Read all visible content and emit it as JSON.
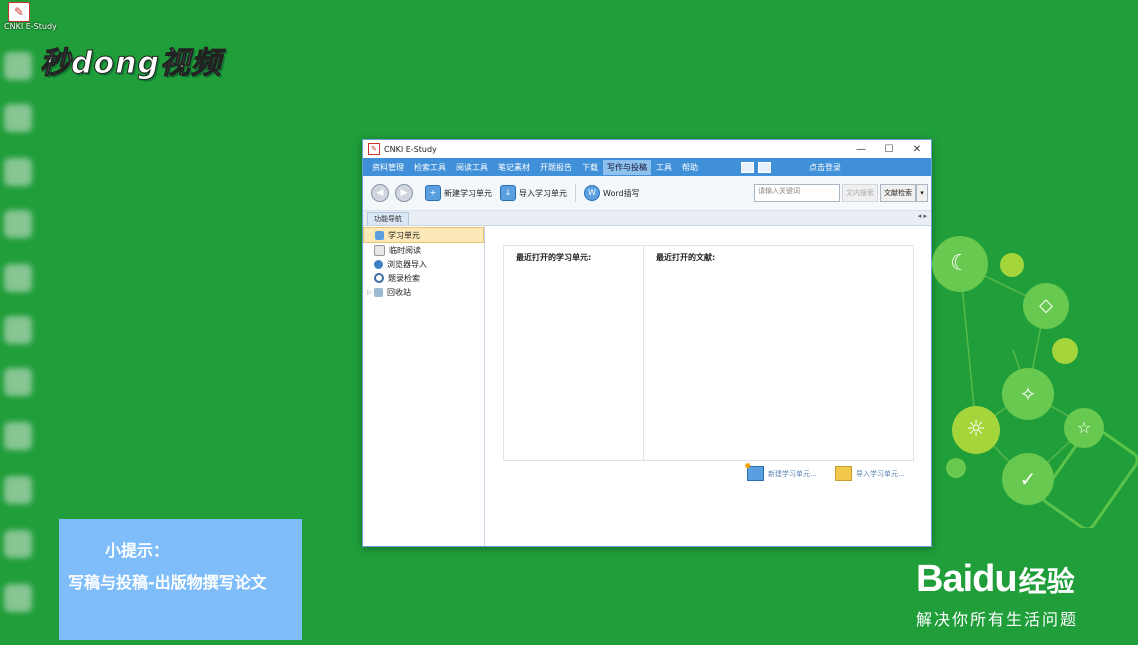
{
  "desktop": {
    "top_icon_caption": "CNKI E-Study",
    "watermark": "秒dong视频"
  },
  "window": {
    "title": "CNKI E-Study",
    "menu": [
      "资料管理",
      "检索工具",
      "阅读工具",
      "笔记素材",
      "开题报告",
      "下载",
      "写作与投稿",
      "工具",
      "帮助"
    ],
    "active_menu": "写作与投稿",
    "login": "点击登录",
    "toolbar": {
      "new_unit": "新建学习单元",
      "import_unit": "导入学习单元",
      "word": "Word插写",
      "search_placeholder": "请输入关键词",
      "search_btn": "文内搜索",
      "lit_btn": "文献检索"
    },
    "nav_tab": "功能导航",
    "tree": [
      "学习单元",
      "临时阅读",
      "浏览器导入",
      "题录检索",
      "回收站"
    ],
    "recent_units_label": "最近打开的学习单元:",
    "recent_docs_label": "最近打开的文献:",
    "link_new": "新建学习单元...",
    "link_import": "导入学习单元..."
  },
  "tip": {
    "title": "小提示：",
    "text": "写稿与投稿-出版物撰写论文"
  },
  "baidu": {
    "logo": "Bai",
    "logo_du": "du",
    "jingyan": "经验",
    "slogan": "解决你所有生活问题"
  }
}
